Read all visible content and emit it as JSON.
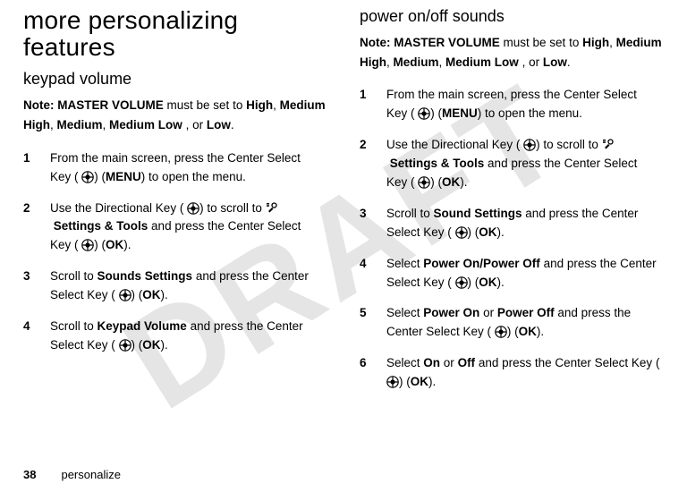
{
  "watermark": "DRAFT",
  "shared": {
    "menu": "MENU",
    "ok": "OK",
    "settings_tools": "Settings & Tools",
    "lp": "(",
    "rp": ")",
    "paren_open": ") "
  },
  "left": {
    "heading": "more personalizing features",
    "subheading": "keypad volume",
    "note": {
      "label": "Note: ",
      "mv": "MASTER VOLUME",
      "mid1": " must be set to ",
      "v1": "High",
      "v2": "Medium High",
      "v3": "Medium",
      "v4": "Medium Low",
      "mid2": ", or ",
      "v5": "Low"
    },
    "steps": [
      {
        "n": "1",
        "a": "From the main screen, press the Center Select Key (",
        "b": " to open the menu."
      },
      {
        "n": "2",
        "a": "Use the Directional Key (",
        "b": " to scroll to ",
        "c": " and press the Center Select Key ("
      },
      {
        "n": "3",
        "a": "Scroll to ",
        "tgt": "Sounds Settings",
        "b": " and press the Center Select Key ("
      },
      {
        "n": "4",
        "a": "Scroll to ",
        "tgt": "Keypad Volume",
        "b": " and press the Center Select Key ("
      }
    ]
  },
  "right": {
    "heading": "power on/off sounds",
    "note": {
      "label": "Note: ",
      "mv": "MASTER VOLUME",
      "mid1": " must be set to ",
      "v1": "High",
      "v2": "Medium High",
      "v3": "Medium",
      "v4": "Medium Low",
      "mid2": ", or ",
      "v5": "Low"
    },
    "steps": [
      {
        "n": "1",
        "a": "From the main screen, press the Center Select Key (",
        "b": " to open the menu."
      },
      {
        "n": "2",
        "a": "Use the Directional Key (",
        "b": " to scroll to ",
        "c": " and press the Center Select Key ("
      },
      {
        "n": "3",
        "a": "Scroll to ",
        "tgt": "Sound Settings",
        "b": " and press the Center Select Key ("
      },
      {
        "n": "4",
        "a": "Select ",
        "tgt": "Power On/Power Off",
        "b": " and press the Center Select Key ("
      },
      {
        "n": "5",
        "a": "Select ",
        "o1": "Power On",
        "or": " or ",
        "o2": "Power Off",
        "b": " and press the Center Select Key ("
      },
      {
        "n": "6",
        "a": "Select ",
        "o1": "On",
        "or": " or ",
        "o2": "Off",
        "b": " and press the Center Select Key ("
      }
    ]
  },
  "footer": {
    "page": "38",
    "section": "personalize"
  }
}
